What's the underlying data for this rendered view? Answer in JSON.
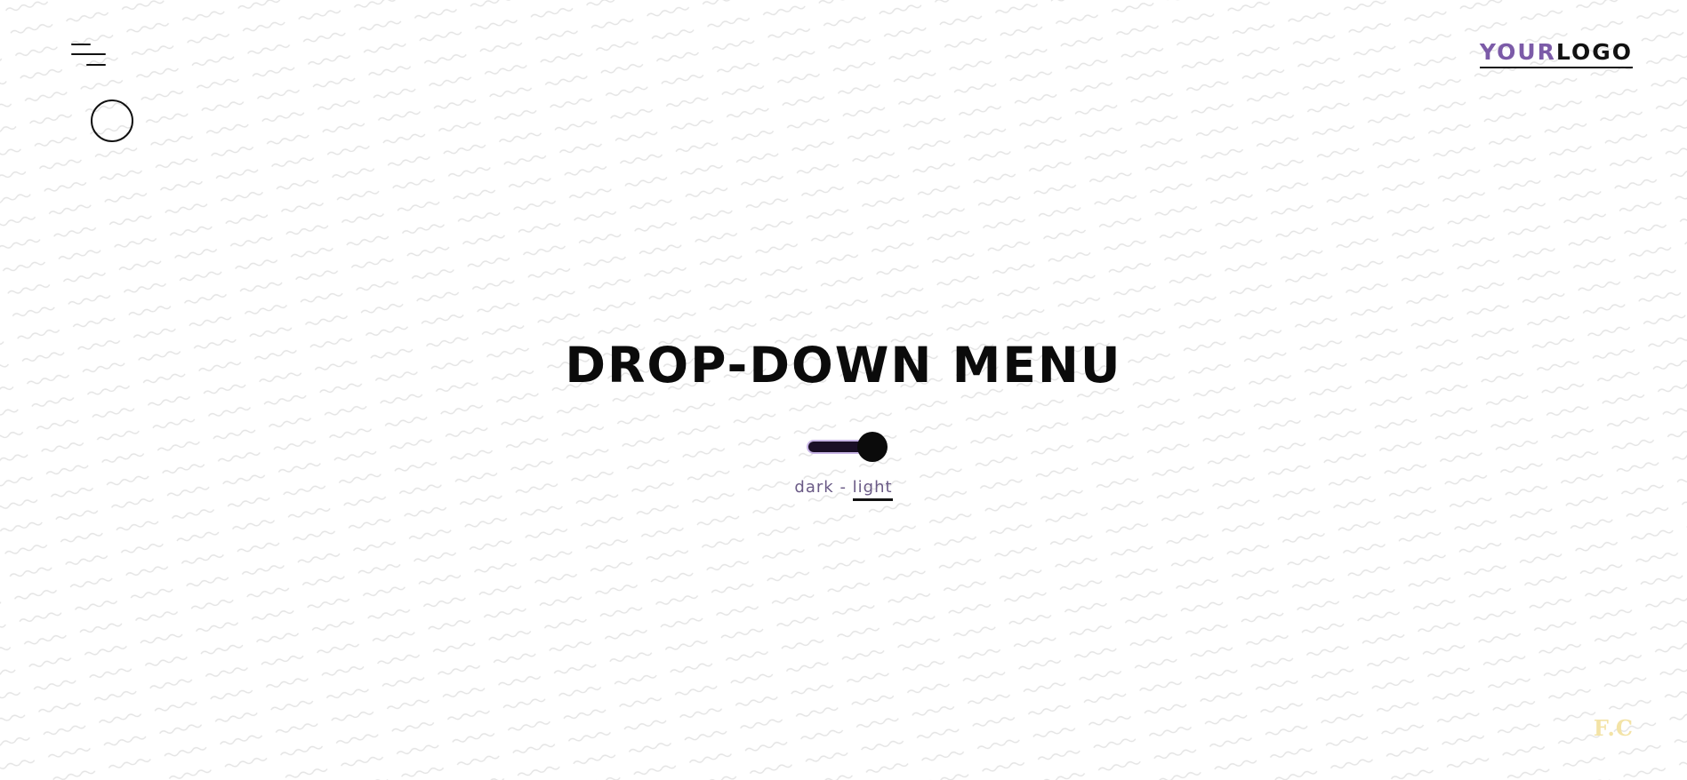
{
  "header": {
    "logo_prefix": "YOUR",
    "logo_suffix": "LOGO"
  },
  "main": {
    "title": "DROP-DOWN MENU"
  },
  "theme_switch": {
    "dark_label": "dark",
    "separator": "-",
    "light_label": "light",
    "selected": "light"
  },
  "footer": {
    "signature": "F.C"
  },
  "colors": {
    "accent": "#7c5ba8",
    "text": "#0b0b0b",
    "label": "#6a5a86",
    "signature": "#f3e3a6"
  },
  "icons": {
    "menu": "hamburger-menu-icon",
    "cursor": "circle-cursor-icon"
  }
}
